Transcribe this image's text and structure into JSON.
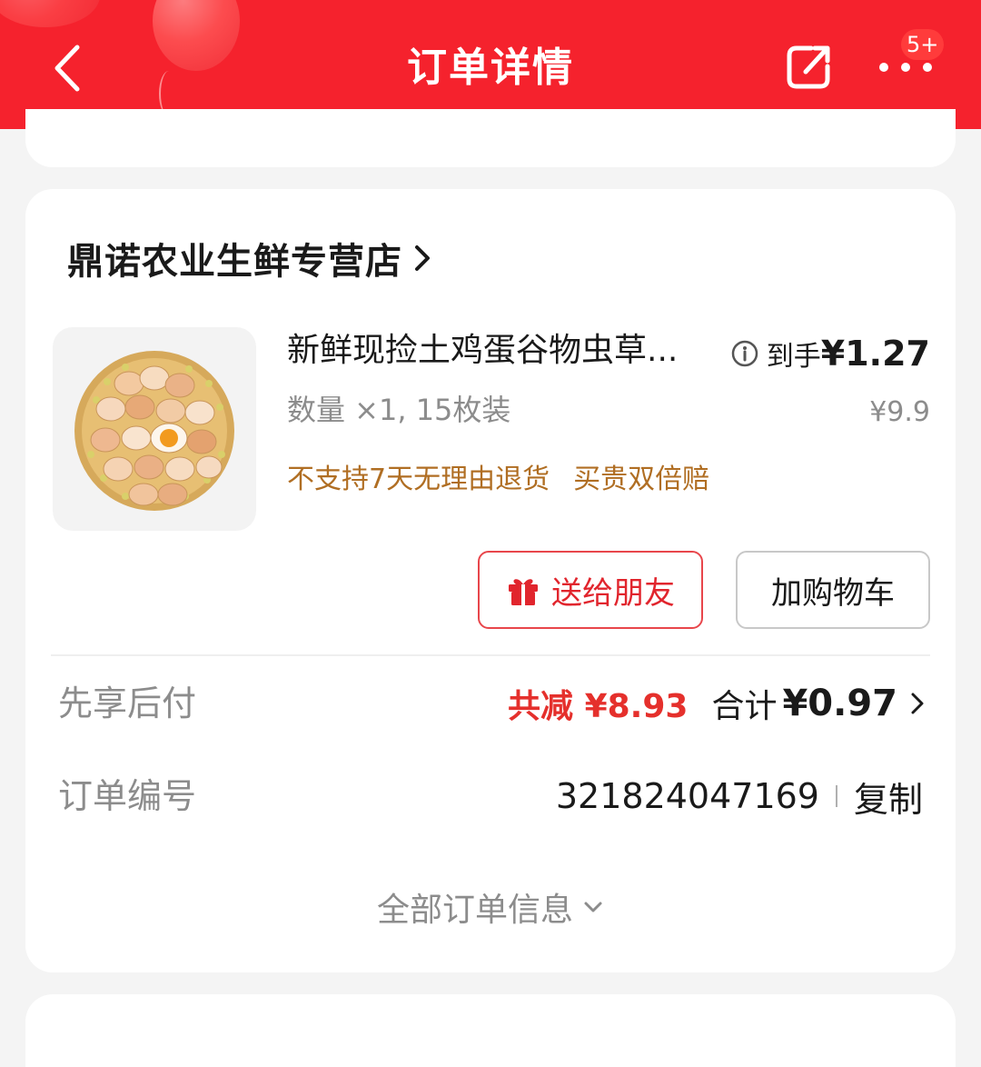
{
  "header": {
    "title": "订单详情",
    "notification_badge": "5+",
    "bar_color": "#f5222d"
  },
  "icons": {
    "back": "chevron-left-icon",
    "share": "share-icon",
    "more": "more-dots-icon",
    "store_chevron": "chevron-right-icon",
    "info": "info-icon",
    "gift": "gift-icon",
    "expand": "chevron-down-icon"
  },
  "store": {
    "name": "鼎诺农业生鲜专营店"
  },
  "product": {
    "title": "新鲜现捡土鸡蛋谷物虫草...",
    "final_price_label": "到手",
    "final_price": "¥1.27",
    "spec": "数量 ×1, 15枚装",
    "original_price": "¥9.9",
    "service_tags": [
      "不支持7天无理由退货",
      "买贵双倍赔"
    ]
  },
  "actions": {
    "gift_label": "送给朋友",
    "cart_label": "加购物车"
  },
  "payment": {
    "label": "先享后付",
    "discount": "共减 ¥8.93",
    "total_label": "合计",
    "total": "¥0.97"
  },
  "order": {
    "number_label": "订单编号",
    "number": "321824047169",
    "copy_label": "复制"
  },
  "footer": {
    "all_info_label": "全部订单信息"
  },
  "colors": {
    "accent_red": "#e5302c",
    "tag_brown": "#b06e23",
    "muted_text": "#8c8c8c"
  }
}
